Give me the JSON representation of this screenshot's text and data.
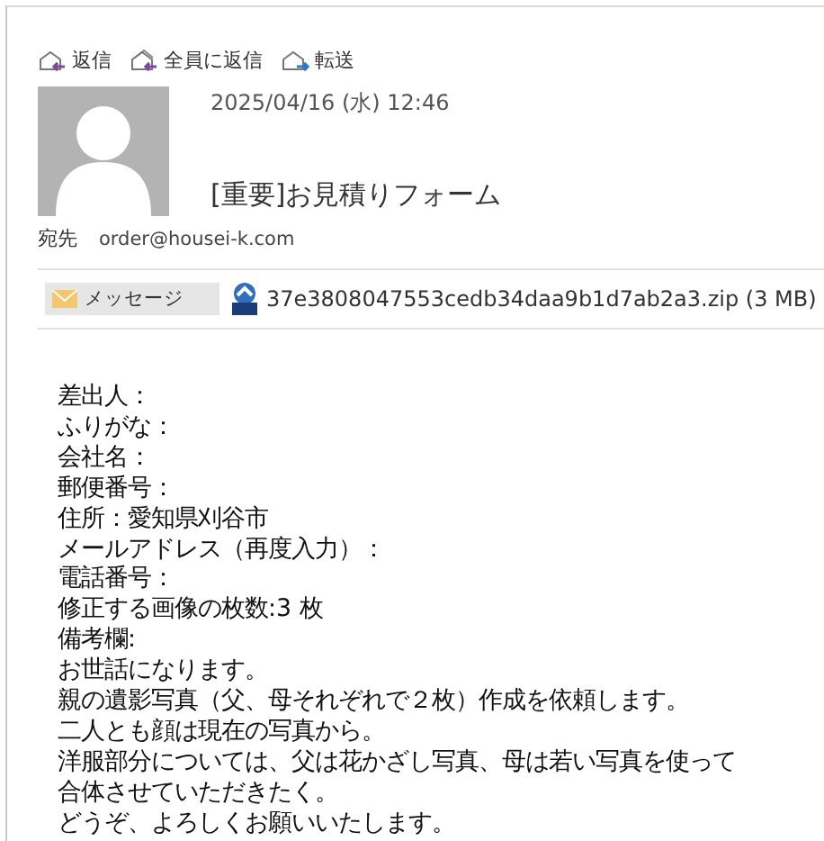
{
  "actions": [
    {
      "label": "返信",
      "kind": "reply"
    },
    {
      "label": "全員に返信",
      "kind": "reply_all"
    },
    {
      "label": "転送",
      "kind": "forward"
    }
  ],
  "header": {
    "date": "2025/04/16 (水) 12:46",
    "subject": "[重要]お見積りフォーム",
    "to_label": "宛先",
    "to": "order@housei-k.com"
  },
  "attachments": [
    {
      "label": "メッセージ",
      "kind": "message",
      "selected": true
    },
    {
      "label": "37e3808047553cedb34daa9b1d7ab2a3.zip (3 MB)",
      "kind": "zip",
      "selected": false
    }
  ],
  "body": [
    "差出人：",
    "ふりがな：",
    "会社名：",
    "郵便番号：",
    "住所：愛知県刈谷市",
    "メールアドレス（再度入力）：",
    "電話番号：",
    "修正する画像の枚数:3 枚",
    "備考欄:",
    "お世話になります。",
    "親の遺影写真（父、母それぞれで２枚）作成を依頼します。",
    "二人とも顔は現在の写真から。",
    "洋服部分については、父は花かざし写真、母は若い写真を使って",
    "合体させていただきたく。",
    "どうぞ、よろしくお願いいたします。"
  ]
}
